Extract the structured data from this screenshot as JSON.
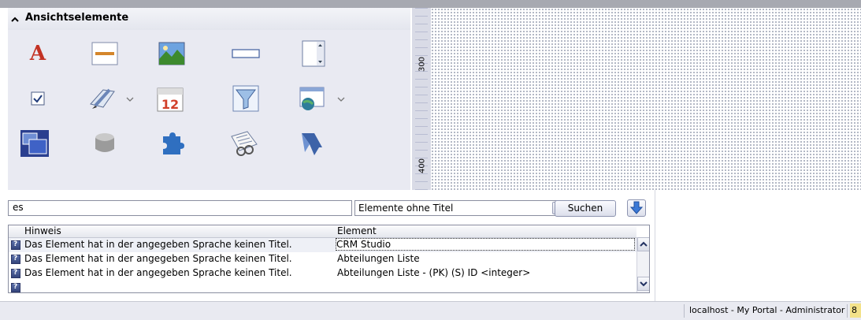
{
  "palette": {
    "title": "Ansichtselemente",
    "icons": [
      "text-icon",
      "line-icon",
      "image-icon",
      "textbox-icon",
      "listbox-icon",
      "checkbox-icon",
      "edit-icon",
      "calendar-icon",
      "filter-icon",
      "grid-icon",
      "container-icon",
      "cube-icon",
      "puzzle-icon",
      "report-icon",
      "ribbon-icon"
    ]
  },
  "ruler": {
    "labels": [
      "300",
      "400"
    ]
  },
  "search": {
    "value": "es",
    "filter_selected": "Elemente ohne Titel",
    "search_button": "Suchen"
  },
  "table": {
    "headers": [
      "Hinweis",
      "Element"
    ],
    "rows": [
      {
        "hint": "Das Element hat in der angegeben Sprache keinen Titel.",
        "element": "CRM Studio"
      },
      {
        "hint": "Das Element hat in der angegeben Sprache keinen Titel.",
        "element": "Abteilungen Liste"
      },
      {
        "hint": "Das Element hat in der angegeben Sprache keinen Titel.",
        "element": "Abteilungen Liste - (PK) (S) ID <integer>"
      }
    ]
  },
  "status": {
    "connection": "localhost - My Portal - Administrator",
    "indicator": "8"
  }
}
